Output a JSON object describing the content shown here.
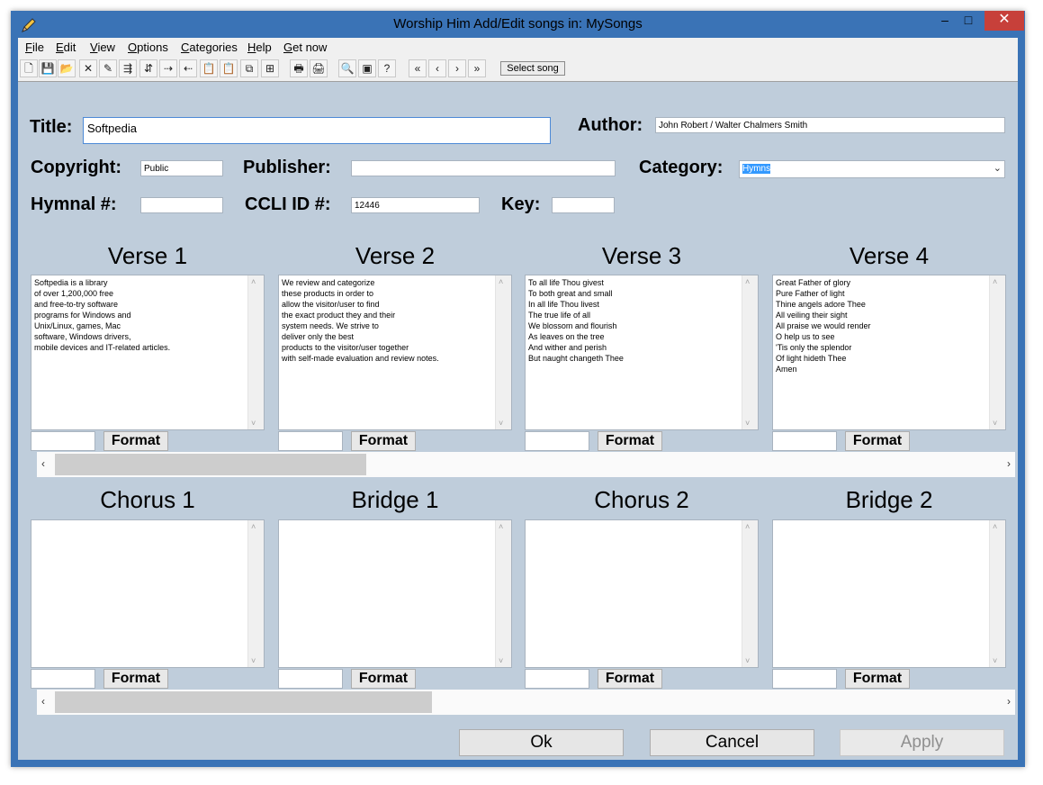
{
  "window": {
    "title": "Worship Him  Add/Edit songs in: MySongs",
    "controls": {
      "minimize": "–",
      "maximize": "□",
      "close": "✕"
    }
  },
  "menu": [
    "File",
    "Edit",
    "View",
    "Options",
    "Categories",
    "Help",
    "Get now"
  ],
  "toolbar": {
    "icons": [
      "new-icon",
      "save-icon",
      "open-icon",
      "delete-icon",
      "edit-icon",
      "import-icon",
      "export-icon",
      "send-icon",
      "receive-icon",
      "paste-icon",
      "paste-special-icon",
      "copy-icon",
      "merge-icon",
      "print-icon",
      "print-preview-icon",
      "find-icon",
      "display-icon",
      "help-icon",
      "first-icon",
      "prev-icon",
      "next-icon",
      "last-icon"
    ],
    "glyphs": [
      "🗋",
      "💾",
      "📂",
      "✕",
      "✎",
      "⇶",
      "⇵",
      "⇢",
      "⇠",
      "📋",
      "📋",
      "⧉",
      "⊞",
      "🖶",
      "🖨",
      "🔍",
      "▣",
      "?",
      "«",
      "‹",
      "›",
      "»"
    ],
    "select_song": "Select song"
  },
  "form": {
    "title_label": "Title:",
    "title_value": "Softpedia",
    "author_label": "Author:",
    "author_value": "John Robert / Walter Chalmers Smith",
    "copyright_label": "Copyright:",
    "copyright_value": "Public",
    "publisher_label": "Publisher:",
    "publisher_value": "",
    "category_label": "Category:",
    "category_value": "Hymns",
    "hymnal_label": "Hymnal #:",
    "hymnal_value": "",
    "ccli_label": "CCLI ID #:",
    "ccli_value": "12446",
    "key_label": "Key:",
    "key_value": ""
  },
  "sections_top": [
    {
      "title": "Verse 1",
      "text": "Softpedia is a library\nof over 1,200,000 free\nand free-to-try software\nprograms for Windows and\nUnix/Linux, games, Mac\nsoftware, Windows drivers,\nmobile devices and IT-related articles.",
      "format": "Format"
    },
    {
      "title": "Verse 2",
      "text": "We review and categorize\nthese products in order to\nallow the visitor/user to find\nthe exact product they and their\nsystem needs. We strive to\ndeliver only the best\nproducts to the visitor/user together\nwith self-made evaluation and review notes.",
      "format": "Format"
    },
    {
      "title": "Verse 3",
      "text": "To all life Thou givest\nTo both great and small\nIn all life Thou livest\nThe true life of all\nWe blossom and flourish\nAs leaves on the tree\nAnd wither and perish\nBut naught changeth Thee",
      "format": "Format"
    },
    {
      "title": "Verse 4",
      "text": "Great Father of glory\nPure Father of light\nThine angels adore Thee\nAll veiling their sight\nAll praise we would render\nO help us to see\n'Tis only the splendor\nOf light hideth Thee\nAmen",
      "format": "Format"
    }
  ],
  "sections_bottom": [
    {
      "title": "Chorus 1",
      "text": "",
      "format": "Format"
    },
    {
      "title": "Bridge 1",
      "text": "",
      "format": "Format"
    },
    {
      "title": "Chorus 2",
      "text": "",
      "format": "Format"
    },
    {
      "title": "Bridge 2",
      "text": "",
      "format": "Format"
    }
  ],
  "scrollbar_top_fraction": 0.33,
  "scrollbar_bottom_fraction": 0.4,
  "buttons": {
    "ok": "Ok",
    "cancel": "Cancel",
    "apply": "Apply"
  }
}
